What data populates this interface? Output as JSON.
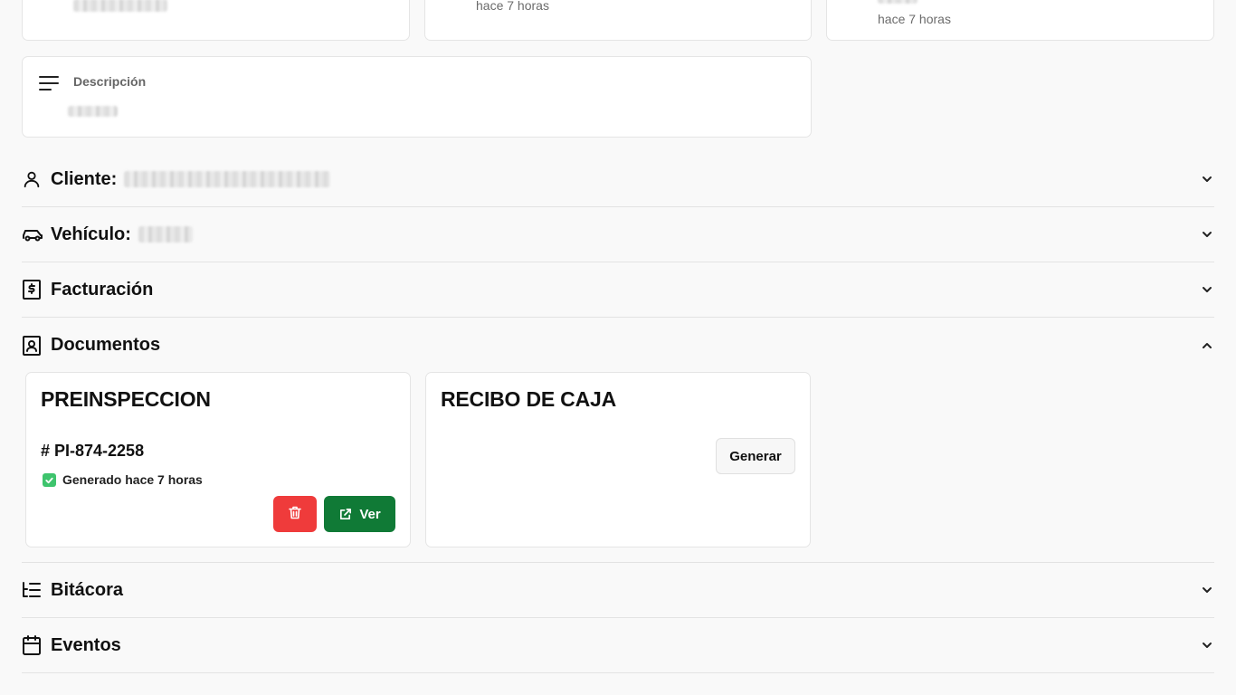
{
  "top_cards": [
    {
      "time": ""
    },
    {
      "time": "hace 7 horas"
    },
    {
      "time": "hace 7 horas"
    }
  ],
  "description": {
    "label": "Descripción",
    "icon": "text-align-left-icon"
  },
  "sections": {
    "cliente": {
      "title": "Cliente:",
      "icon": "user-icon",
      "expanded": false
    },
    "vehiculo": {
      "title": "Vehículo:",
      "icon": "car-icon",
      "expanded": false
    },
    "facturacion": {
      "title": "Facturación",
      "icon": "receipt-dollar-icon",
      "expanded": false
    },
    "documentos": {
      "title": "Documentos",
      "icon": "user-square-icon",
      "expanded": true
    },
    "bitacora": {
      "title": "Bitácora",
      "icon": "list-tree-icon",
      "expanded": false
    },
    "eventos": {
      "title": "Eventos",
      "icon": "calendar-icon",
      "expanded": false
    }
  },
  "documents": [
    {
      "title": "PREINSPECCION",
      "number": "# PI-874-2258",
      "status": "Generado hace 7 horas",
      "delete_icon": "trash-icon",
      "view_label": "Ver",
      "view_icon": "external-link-icon"
    },
    {
      "title": "RECIBO DE CAJA",
      "generate_label": "Generar"
    }
  ],
  "colors": {
    "page_bg": "#f9f9f9",
    "delete": "#ef3b3b",
    "view": "#107a36",
    "check": "#3ec46d"
  }
}
